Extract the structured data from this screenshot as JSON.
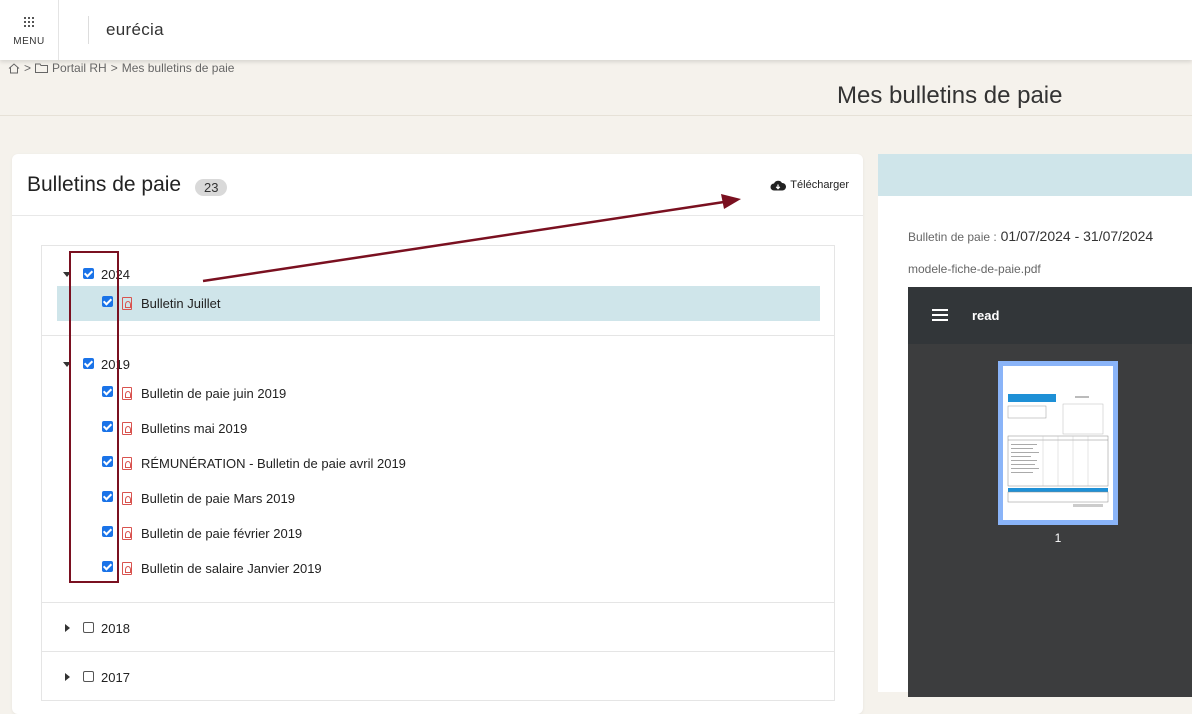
{
  "header": {
    "menu_label": "MENU",
    "logo_text": "eurécia"
  },
  "breadcrumb": {
    "sep1": ">",
    "portal": "Portail RH",
    "sep2": ">",
    "current": "Mes bulletins de paie"
  },
  "page_title": "Mes bulletins de paie",
  "panel": {
    "title": "Bulletins de paie",
    "count": "23",
    "download_label": "Télécharger"
  },
  "groups": [
    {
      "year": "2024",
      "expanded": true,
      "checked": true,
      "items": [
        {
          "label": "Bulletin Juillet",
          "checked": true,
          "selected": true
        }
      ]
    },
    {
      "year": "2019",
      "expanded": true,
      "checked": true,
      "items": [
        {
          "label": "Bulletin de paie juin 2019",
          "checked": true
        },
        {
          "label": "Bulletins mai 2019",
          "checked": true
        },
        {
          "label": "RÉMUNÉRATION - Bulletin de paie avril 2019",
          "checked": true
        },
        {
          "label": "Bulletin de paie Mars 2019",
          "checked": true
        },
        {
          "label": "Bulletin de paie février 2019",
          "checked": true
        },
        {
          "label": "Bulletin de salaire Janvier 2019",
          "checked": true
        }
      ]
    },
    {
      "year": "2018",
      "expanded": false,
      "checked": false,
      "items": []
    },
    {
      "year": "2017",
      "expanded": false,
      "checked": false,
      "items": []
    }
  ],
  "preview": {
    "period_label": "Bulletin de paie :",
    "period_value": "01/07/2024 - 31/07/2024",
    "filename": "modele-fiche-de-paie.pdf",
    "viewer_title": "read",
    "page_number": "1"
  },
  "colors": {
    "accent_blue": "#1a73e8",
    "selected_row": "#cfe5ea",
    "annotation": "#7a1020",
    "pdf_icon": "#d9534f"
  }
}
